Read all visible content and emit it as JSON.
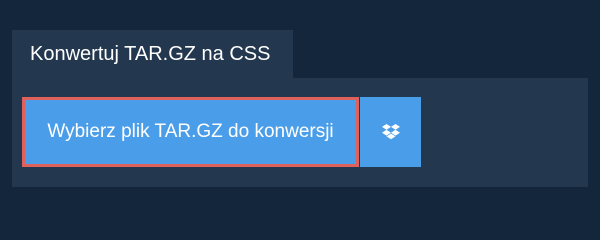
{
  "tab": {
    "title": "Konwertuj TAR.GZ na CSS"
  },
  "panel": {
    "select_button_label": "Wybierz plik TAR.GZ do konwersji",
    "dropbox_icon": "dropbox-icon"
  },
  "colors": {
    "page_background": "#13263c",
    "panel_background": "#23384f",
    "button_blue": "#4a9de8",
    "highlight_border": "#e0605b"
  }
}
